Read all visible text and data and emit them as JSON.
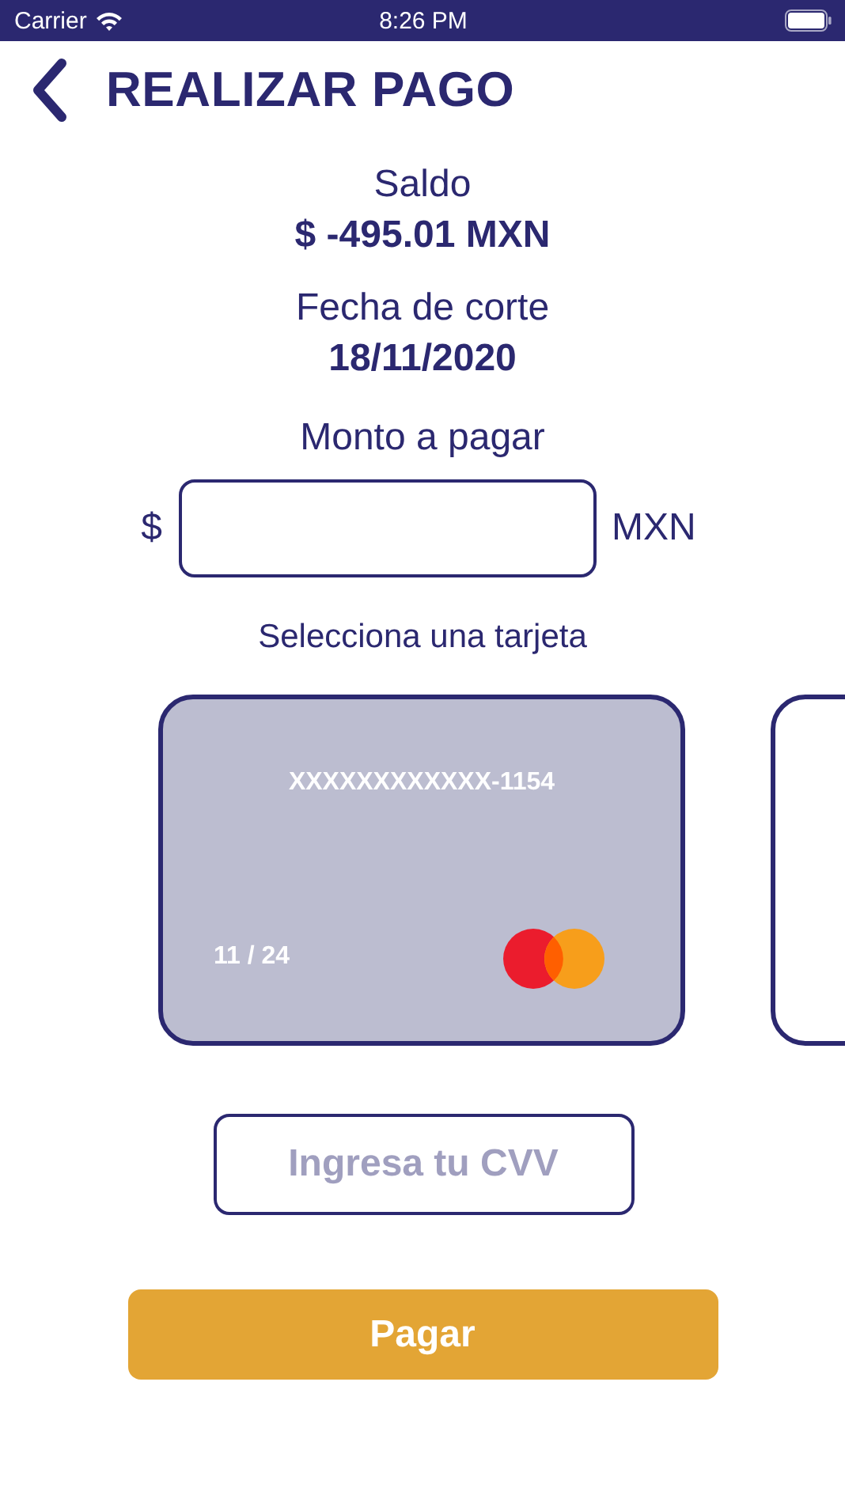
{
  "status_bar": {
    "carrier": "Carrier",
    "time": "8:26 PM"
  },
  "header": {
    "title": "REALIZAR PAGO"
  },
  "balance": {
    "label": "Saldo",
    "value": "$ -495.01 MXN"
  },
  "cutoff": {
    "label": "Fecha de corte",
    "value": "18/11/2020"
  },
  "amount": {
    "label": "Monto a pagar",
    "prefix": "$",
    "suffix": "MXN"
  },
  "cards_label": "Selecciona una tarjeta",
  "cards": [
    {
      "number": "XXXXXXXXXXXX-1154",
      "expiry": "11 / 24",
      "selected": true
    },
    {
      "selected": false
    }
  ],
  "cvv": {
    "placeholder": "Ingresa tu CVV"
  },
  "pay_button": "Pagar"
}
